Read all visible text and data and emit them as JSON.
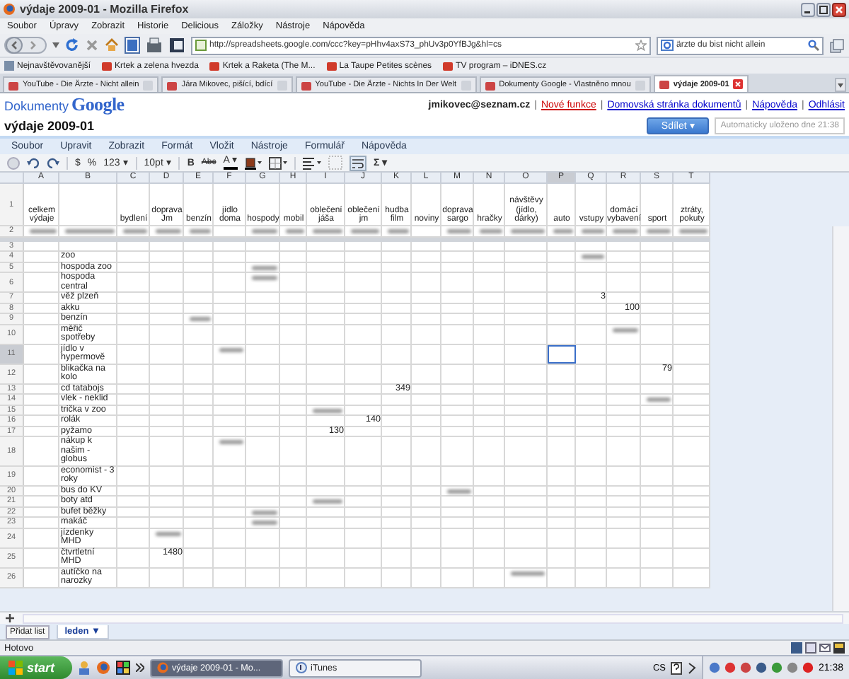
{
  "window": {
    "title": "výdaje 2009-01 - Mozilla Firefox"
  },
  "menu": [
    "Soubor",
    "Úpravy",
    "Zobrazit",
    "Historie",
    "Delicious",
    "Záložky",
    "Nástroje",
    "Nápověda"
  ],
  "address_bar": {
    "url": "http://spreadsheets.google.com/ccc?key=pHhv4axS73_phUv3p0YfBJg&hl=cs"
  },
  "search_box": {
    "value": "ärzte du bist nicht allein"
  },
  "bookmarks": [
    "Nejnavštěvovanější",
    "Krtek a zelena hvezda",
    "Krtek a Raketa (The M...",
    "La Taupe Petites scènes",
    "TV program – iDNES.cz"
  ],
  "tabs": [
    {
      "label": "YouTube - Die Ärzte - Nicht allein",
      "selected": false
    },
    {
      "label": "Jára Mikovec, pišící, bdící",
      "selected": false
    },
    {
      "label": "YouTube - Die Ärzte - Nichts In Der Welt",
      "selected": false
    },
    {
      "label": "Dokumenty Google - Vlastněno mnou",
      "selected": false
    },
    {
      "label": "výdaje 2009-01",
      "selected": true
    }
  ],
  "docs_header": {
    "logo_text": "Dokumenty",
    "logo_brand": "Google",
    "user": "jmikovec@seznam.cz",
    "separator": "|",
    "links": [
      {
        "label": "Nové funkce",
        "color": "#cc0000"
      },
      {
        "label": "Domovská stránka dokumentů",
        "color": "#0000cc"
      },
      {
        "label": "Nápověda",
        "color": "#0000cc"
      },
      {
        "label": "Odhlásit",
        "color": "#0000cc"
      }
    ],
    "title": "výdaje 2009-01",
    "share_button": "Sdílet ▾",
    "save_status": "Automaticky uloženo dne 21:38"
  },
  "app_menu": [
    "Soubor",
    "Upravit",
    "Zobrazit",
    "Formát",
    "Vložit",
    "Nástroje",
    "Formulář",
    "Nápověda"
  ],
  "toolbar": {
    "format_buttons": [
      "$",
      "%",
      "123 ▾"
    ],
    "font_size": "10pt ▾",
    "style_buttons": [
      "B",
      "Abc",
      "A ▾"
    ],
    "function_button": "Σ ▾"
  },
  "sheet": {
    "columns": [
      {
        "letter": "A",
        "selected": false
      },
      {
        "letter": "B",
        "selected": false
      },
      {
        "letter": "C",
        "selected": false
      },
      {
        "letter": "D",
        "selected": false
      },
      {
        "letter": "E",
        "selected": false
      },
      {
        "letter": "F",
        "selected": false
      },
      {
        "letter": "G",
        "selected": false
      },
      {
        "letter": "H",
        "selected": false
      },
      {
        "letter": "I",
        "selected": false
      },
      {
        "letter": "J",
        "selected": false
      },
      {
        "letter": "K",
        "selected": false
      },
      {
        "letter": "L",
        "selected": false
      },
      {
        "letter": "M",
        "selected": false
      },
      {
        "letter": "N",
        "selected": false
      },
      {
        "letter": "O",
        "selected": false
      },
      {
        "letter": "P",
        "selected": true
      },
      {
        "letter": "Q",
        "selected": false
      },
      {
        "letter": "R",
        "selected": false
      },
      {
        "letter": "S",
        "selected": false
      },
      {
        "letter": "T",
        "selected": false
      }
    ],
    "header_row": {
      "number": "1",
      "cells": [
        "celkem výdaje",
        "",
        "bydlení",
        "doprava Jm",
        "benzín",
        "jídlo doma",
        "hospody",
        "mobil",
        "oblečení jáša",
        "oblečení jm",
        "hudba film",
        "noviny",
        "doprava sargo",
        "hračky",
        "návštěvy (jídlo, dárky)",
        "auto",
        "vstupy",
        "domácí vybavení",
        "sport",
        "ztráty, pokuty"
      ]
    },
    "rows": [
      {
        "number": "2",
        "selected": false,
        "cells": [
          {
            "kind": "blurred"
          },
          {
            "kind": "blurred"
          },
          {
            "kind": "blurred"
          },
          {
            "kind": "blurred"
          },
          {
            "kind": "blurred"
          },
          "",
          {
            "kind": "blurred"
          },
          {
            "kind": "blurred"
          },
          {
            "kind": "blurred"
          },
          {
            "kind": "blurred"
          },
          {
            "kind": "blurred"
          },
          "",
          {
            "kind": "blurred"
          },
          {
            "kind": "blurred"
          },
          {
            "kind": "blurred"
          },
          {
            "kind": "blurred"
          },
          {
            "kind": "blurred"
          },
          {
            "kind": "blurred"
          },
          {
            "kind": "blurred"
          },
          {
            "kind": "blurred"
          }
        ]
      },
      {
        "number": "3",
        "selected": false,
        "cells": []
      },
      {
        "number": "4",
        "selected": false,
        "cells": [
          "",
          "zoo",
          "",
          "",
          "",
          "",
          "",
          "",
          "",
          "",
          "",
          "",
          "",
          "",
          "",
          "",
          {
            "kind": "blurred"
          }
        ]
      },
      {
        "number": "5",
        "selected": false,
        "cells": [
          "",
          "hospoda zoo",
          "",
          "",
          "",
          "",
          {
            "kind": "blurred"
          }
        ]
      },
      {
        "number": "6",
        "selected": false,
        "cells": [
          "",
          "hospoda central",
          "",
          "",
          "",
          "",
          {
            "kind": "blurred"
          }
        ]
      },
      {
        "number": "7",
        "selected": false,
        "cells": [
          "",
          "věž plzeň",
          "",
          "",
          "",
          "",
          "",
          "",
          "",
          "",
          "",
          "",
          "",
          "",
          "",
          "",
          "3"
        ]
      },
      {
        "number": "8",
        "selected": false,
        "cells": [
          "",
          "akku",
          "",
          "",
          "",
          "",
          "",
          "",
          "",
          "",
          "",
          "",
          "",
          "",
          "",
          "",
          "",
          "100"
        ]
      },
      {
        "number": "9",
        "selected": false,
        "cells": [
          "",
          "benzín",
          "",
          "",
          {
            "kind": "blurred"
          }
        ]
      },
      {
        "number": "10",
        "selected": false,
        "cells": [
          "",
          "měřič spotřeby",
          "",
          "",
          "",
          "",
          "",
          "",
          "",
          "",
          "",
          "",
          "",
          "",
          "",
          "",
          "",
          {
            "kind": "blurred"
          }
        ]
      },
      {
        "number": "11",
        "selected": true,
        "cells": [
          "",
          "jídlo v hypermově",
          "",
          "",
          "",
          {
            "kind": "blurred"
          }
        ]
      },
      {
        "number": "12",
        "selected": false,
        "cells": [
          "",
          "blikačka na kolo",
          "",
          "",
          "",
          "",
          "",
          "",
          "",
          "",
          "",
          "",
          "",
          "",
          "",
          "",
          "",
          "",
          "79"
        ]
      },
      {
        "number": "13",
        "selected": false,
        "cells": [
          "",
          "cd tatabojs",
          "",
          "",
          "",
          "",
          "",
          "",
          "",
          "",
          "349"
        ]
      },
      {
        "number": "14",
        "selected": false,
        "cells": [
          "",
          "vlek - neklid",
          "",
          "",
          "",
          "",
          "",
          "",
          "",
          "",
          "",
          "",
          "",
          "",
          "",
          "",
          "",
          "",
          {
            "kind": "blurred"
          }
        ]
      },
      {
        "number": "15",
        "selected": false,
        "cells": [
          "",
          "trička v zoo",
          "",
          "",
          "",
          "",
          "",
          "",
          {
            "kind": "blurred"
          }
        ]
      },
      {
        "number": "16",
        "selected": false,
        "cells": [
          "",
          "rolák",
          "",
          "",
          "",
          "",
          "",
          "",
          "",
          "140"
        ]
      },
      {
        "number": "17",
        "selected": false,
        "cells": [
          "",
          "pyžamo",
          "",
          "",
          "",
          "",
          "",
          "",
          "130"
        ]
      },
      {
        "number": "18",
        "selected": false,
        "cells": [
          "",
          "nákup k našim - globus",
          "",
          "",
          "",
          {
            "kind": "blurred"
          }
        ]
      },
      {
        "number": "19",
        "selected": false,
        "cells": [
          "",
          "economist - 3 roky"
        ]
      },
      {
        "number": "20",
        "selected": false,
        "cells": [
          "",
          "bus do KV",
          "",
          "",
          "",
          "",
          "",
          "",
          "",
          "",
          "",
          "",
          {
            "kind": "blurred"
          }
        ]
      },
      {
        "number": "21",
        "selected": false,
        "cells": [
          "",
          "boty atd",
          "",
          "",
          "",
          "",
          "",
          "",
          {
            "kind": "blurred"
          }
        ]
      },
      {
        "number": "22",
        "selected": false,
        "cells": [
          "",
          "bufet běžky",
          "",
          "",
          "",
          "",
          {
            "kind": "blurred"
          }
        ]
      },
      {
        "number": "23",
        "selected": false,
        "cells": [
          "",
          "makáč",
          "",
          "",
          "",
          "",
          {
            "kind": "blurred"
          }
        ]
      },
      {
        "number": "24",
        "selected": false,
        "cells": [
          "",
          "jízdenky MHD",
          "",
          {
            "kind": "blurred"
          }
        ]
      },
      {
        "number": "25",
        "selected": false,
        "cells": [
          "",
          "čtvrtletní MHD",
          "",
          "1480"
        ]
      },
      {
        "number": "26",
        "selected": false,
        "cells": [
          "",
          "autíčko na narozky",
          "",
          "",
          "",
          "",
          "",
          "",
          "",
          "",
          "",
          "",
          "",
          "",
          {
            "kind": "blurred"
          }
        ]
      }
    ]
  },
  "sheet_tabs": {
    "add_button": "Přidat list",
    "sheets": [
      {
        "label": "leden ▼",
        "selected": true
      }
    ]
  },
  "status_bar": {
    "text": "Hotovo"
  },
  "taskbar": {
    "start": "start",
    "tasks": [
      {
        "label": "výdaje 2009-01 - Mo...",
        "selected": true
      },
      {
        "label": "iTunes",
        "selected": false
      }
    ],
    "language": "CS",
    "clock": "21:38"
  }
}
